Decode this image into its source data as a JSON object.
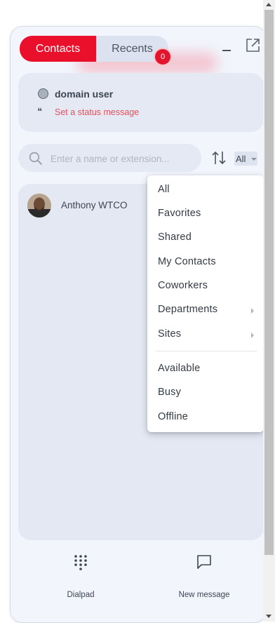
{
  "tabs": {
    "contacts": "Contacts",
    "recents": "Recents",
    "recents_badge": "0"
  },
  "user": {
    "name": "domain user",
    "status_message": "Set a status message"
  },
  "search": {
    "placeholder": "Enter a name or extension...",
    "value": ""
  },
  "filter": {
    "selected": "All"
  },
  "contacts": [
    {
      "name": "Anthony WTCO"
    }
  ],
  "filter_menu": {
    "items": [
      "All",
      "Favorites",
      "Shared",
      "My Contacts",
      "Coworkers",
      "Departments",
      "Sites"
    ],
    "presence_items": [
      "Available",
      "Busy",
      "Offline"
    ]
  },
  "bottom_nav": {
    "dialpad": "Dialpad",
    "new_message": "New message"
  },
  "colors": {
    "accent": "#ea0f2b",
    "status_text": "#e4505e",
    "panel_bg": "#f2f5fc"
  },
  "icons": [
    "search-icon",
    "sort-icon",
    "minimize-icon",
    "popout-icon",
    "quote-icon",
    "dialpad-icon",
    "chat-icon",
    "chevron-right-icon"
  ]
}
